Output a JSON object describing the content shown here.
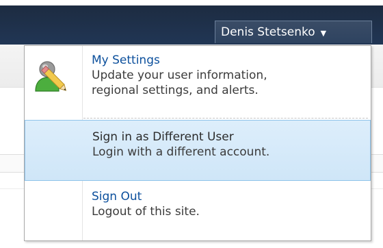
{
  "user_menu": {
    "user_name": "Denis Stetsenko",
    "caret": "▼"
  },
  "menu": {
    "items": [
      {
        "title": "My Settings",
        "description_line1": "Update your user information,",
        "description_line2": "regional settings, and alerts.",
        "icon": "user-settings-icon"
      },
      {
        "title": "Sign in as Different User",
        "description_line1": "Login with a different account."
      },
      {
        "title": "Sign Out",
        "description_line1": "Logout of this site."
      }
    ]
  },
  "colors": {
    "ribbon": "#213655",
    "link": "#0b4f9c",
    "highlight": "#d6eaf9",
    "highlight_border": "#8fc3ea"
  }
}
